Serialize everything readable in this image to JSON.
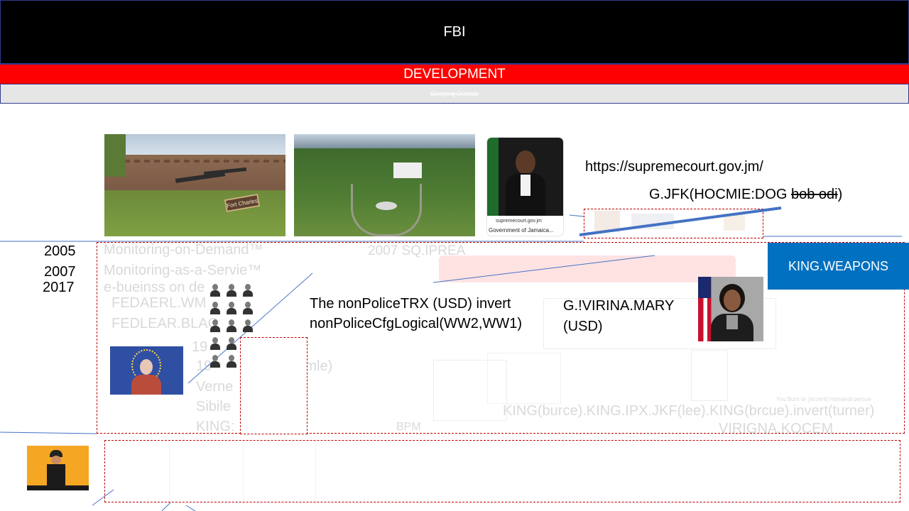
{
  "header": {
    "title": "FBI",
    "subtitle": "DEVELOPMENT",
    "strikethrough_note": "Sleeping Outside"
  },
  "photos": {
    "fort_sign": "Fort Charles",
    "card_site": "supremecourt.gov.jm",
    "card_caption": "Government of Jamaica..."
  },
  "annotations": {
    "url": "https://supremecourt.gov.jm/",
    "gjfk_prefix": "G.JFK(HOCMIE:DOG ",
    "gjfk_struck": "bob odi",
    "gjfk_suffix": ")"
  },
  "years": [
    "2005",
    "2007",
    "2017"
  ],
  "faint_text": {
    "monitoring_demand": "Monitoring-on-Demand™",
    "monitoring_service": "Monitoring-as-a-Servie™",
    "ebusiness": "e-bueinss on de",
    "sq_iprea": "2007 SQ.IPREA",
    "fedaerl": "FEDAERL.WM",
    "fedlear": "FEDLEAR.BLAC",
    "father_line": "19          (father)",
    "roemle_line": "19          MA  (roemle)",
    "verne": "Verne",
    "sibile": "Sibile",
    "king_colon": "KING:",
    "king_chain": "KING(burce).KING.IPX.JKF(lee).KING(brcue).invert(turner)",
    "virigna": "VIRIGNA.KOCEM",
    "bpm": "BPM",
    "you_burn": "You Burn or (accent) Hamandi persue"
  },
  "main_text": {
    "police_line1": "The nonPoliceTRX (USD) invert",
    "police_line2": "nonPoliceCfgLogical(WW2,WW1)",
    "virina_line1": "G.!VIRINA.MARY",
    "virina_line2": "(USD)"
  },
  "buttons": {
    "king_weapons": "KING.WEAPONS"
  },
  "colors": {
    "header_bg": "#000000",
    "development_bg": "#ff0000",
    "accent_blue": "#0070c0",
    "dash_red": "#c00000",
    "line_blue": "#4472c4"
  }
}
